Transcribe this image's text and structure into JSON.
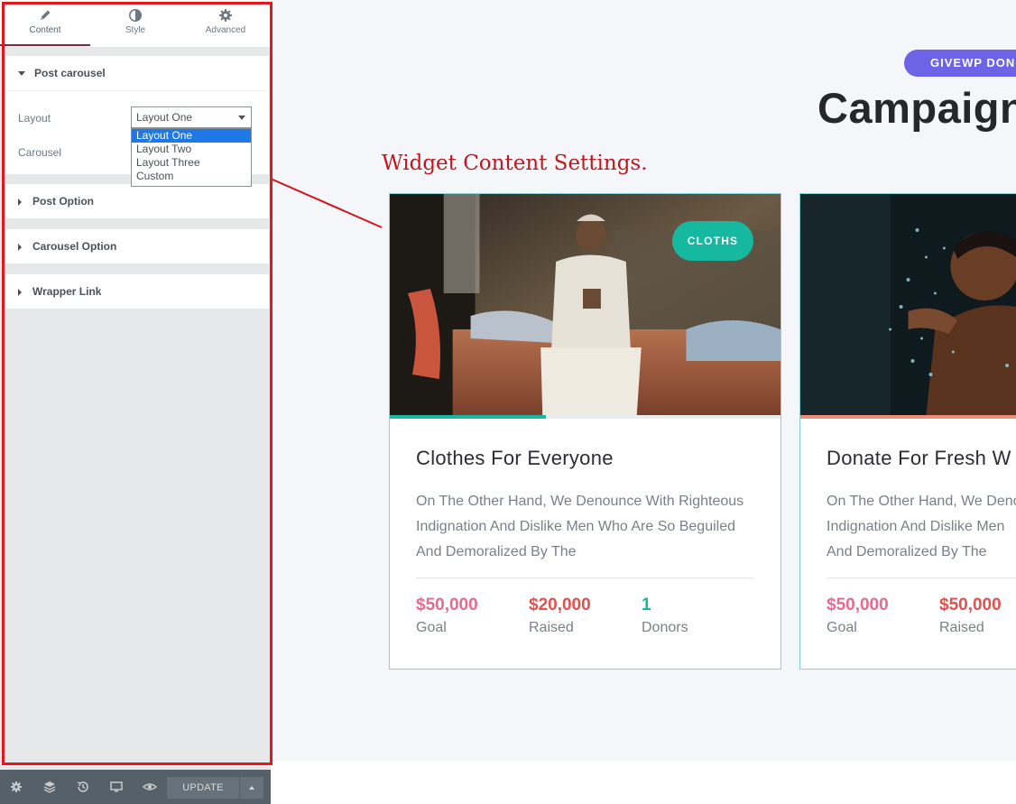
{
  "editor": {
    "tabs": [
      {
        "label": "Content",
        "icon": "pencil-icon"
      },
      {
        "label": "Style",
        "icon": "contrast-icon"
      },
      {
        "label": "Advanced",
        "icon": "gear-icon"
      }
    ],
    "active_tab": "Content",
    "sections": {
      "post_carousel": {
        "title": "Post carousel",
        "layout_label": "Layout",
        "layout_value": "Layout One",
        "layout_options": [
          "Layout One",
          "Layout Two",
          "Layout Three",
          "Custom"
        ],
        "carousel_label": "Carousel"
      },
      "post_option": {
        "title": "Post Option"
      },
      "carousel_option": {
        "title": "Carousel Option"
      },
      "wrapper_link": {
        "title": "Wrapper Link"
      }
    },
    "footer": {
      "icons": [
        "settings-icon",
        "layers-icon",
        "history-icon",
        "responsive-icon",
        "preview-icon"
      ],
      "update_label": "UPDATE"
    }
  },
  "preview": {
    "pill_label": "GIVEWP DON",
    "headline": "Campaign",
    "annotation": "Widget Content Settings.",
    "cards": [
      {
        "badge": "CLOTHS",
        "title": "Clothes For Everyone",
        "description": [
          "On The Other Hand, We Denounce With Righteous",
          "Indignation And Dislike Men Who Are So Beguiled",
          "And Demoralized By The"
        ],
        "progress": 0.4,
        "stats": [
          {
            "value": "$50,000",
            "label": "Goal"
          },
          {
            "value": "$20,000",
            "label": "Raised"
          },
          {
            "value": "1",
            "label": "Donors"
          }
        ]
      },
      {
        "title": "Donate For Fresh W",
        "description": [
          "On The Other Hand, We Deno",
          "Indignation And Dislike Men",
          "And Demoralized By The"
        ],
        "progress": 1.0,
        "stats": [
          {
            "value": "$50,000",
            "label": "Goal"
          },
          {
            "value": "$50,000",
            "label": "Raised"
          }
        ]
      }
    ]
  },
  "colors": {
    "goal": "#e66b8f",
    "raised": "#e2504f",
    "donors": "#17b8a0",
    "progress_card1": "#17b8a0",
    "progress_card2": "#ef8c76",
    "accent_pill": "#6c63e6",
    "annotation_red": "#c0171f"
  }
}
